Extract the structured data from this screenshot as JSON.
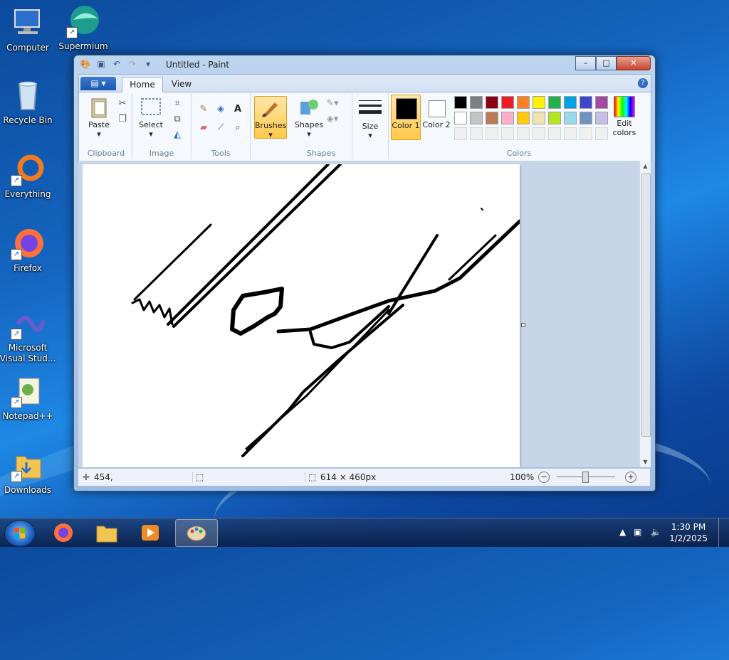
{
  "desktop": {
    "icons": [
      {
        "label": "Computer"
      },
      {
        "label": "Supermium"
      },
      {
        "label": "Recycle Bin"
      },
      {
        "label": "Everything"
      },
      {
        "label": "Firefox"
      },
      {
        "label": "Microsoft Visual Stud..."
      },
      {
        "label": "Notepad++"
      },
      {
        "label": "Downloads"
      }
    ]
  },
  "window": {
    "title": "Untitled - Paint",
    "tabs": {
      "file": "▤ ▾",
      "home": "Home",
      "view": "View"
    },
    "help": "?",
    "groups": {
      "clipboard": {
        "label": "Clipboard",
        "paste": "Paste"
      },
      "image": {
        "label": "Image",
        "select": "Select"
      },
      "tools": {
        "label": "Tools"
      },
      "brushes": {
        "label": "Brushes"
      },
      "shapes": {
        "label": "Shapes",
        "shapes_btn": "Shapes"
      },
      "size": {
        "label": "Size"
      },
      "colors": {
        "label": "Colors",
        "color1": "Color 1",
        "color2": "Color 2",
        "color1_value": "#000000",
        "color2_value": "#ffffff",
        "edit_colors": "Edit colors",
        "palette_row1": [
          "#000000",
          "#7f7f7f",
          "#880015",
          "#ed1c24",
          "#ff7f27",
          "#fff200",
          "#22b14c",
          "#00a2e8",
          "#3f48cc",
          "#a349a4"
        ],
        "palette_row2": [
          "#ffffff",
          "#c3c3c3",
          "#b97a57",
          "#ffaec9",
          "#ffc90e",
          "#efe4b0",
          "#b5e61d",
          "#99d9ea",
          "#7092be",
          "#c8bfe7"
        ]
      }
    },
    "status": {
      "cursor_pos": "454,",
      "image_size": "614 × 460px",
      "zoom": "100%",
      "zoom_value": 100
    }
  },
  "taskbar": {
    "time": "1:30 PM",
    "date": "1/2/2025"
  }
}
